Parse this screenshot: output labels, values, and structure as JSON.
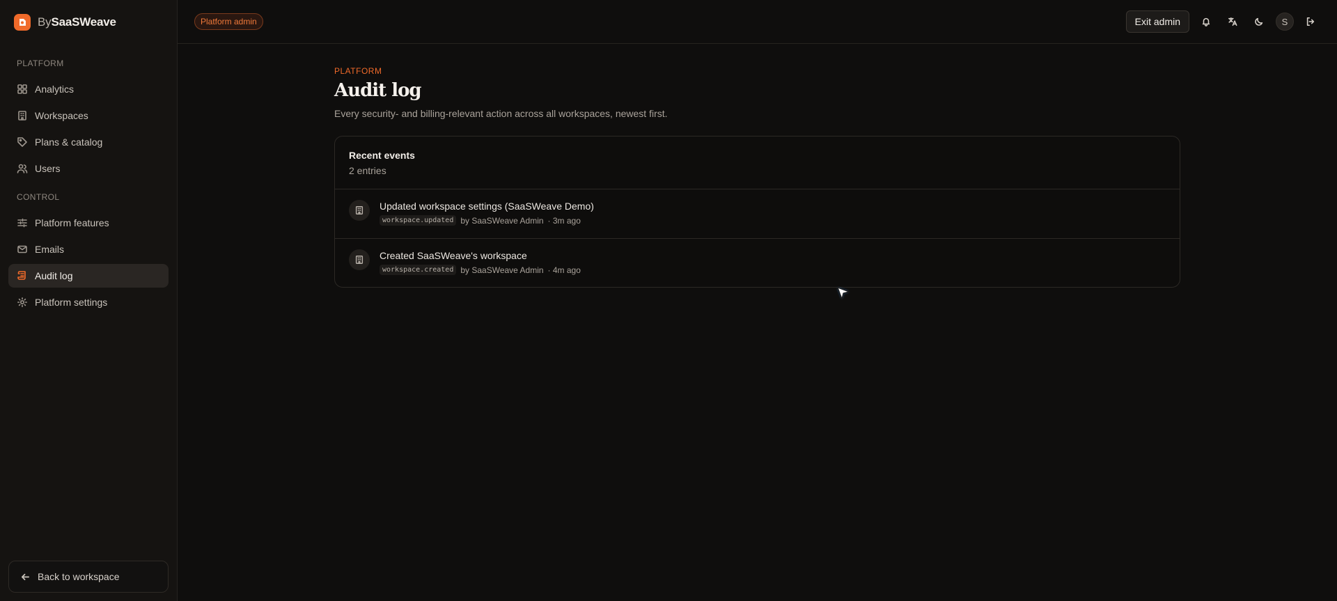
{
  "brand": {
    "prefix": "By",
    "name": "SaaSWeave"
  },
  "sidebar": {
    "sections": [
      {
        "heading": "PLATFORM",
        "items": [
          {
            "label": "Analytics",
            "icon": "grid-icon"
          },
          {
            "label": "Workspaces",
            "icon": "building-icon"
          },
          {
            "label": "Plans & catalog",
            "icon": "tag-icon"
          },
          {
            "label": "Users",
            "icon": "users-icon"
          }
        ]
      },
      {
        "heading": "CONTROL",
        "items": [
          {
            "label": "Platform features",
            "icon": "sliders-icon"
          },
          {
            "label": "Emails",
            "icon": "mail-icon"
          },
          {
            "label": "Audit log",
            "icon": "scroll-icon",
            "active": true
          },
          {
            "label": "Platform settings",
            "icon": "gear-icon"
          }
        ]
      }
    ],
    "back_label": "Back to workspace"
  },
  "topbar": {
    "badge": "Platform admin",
    "exit_label": "Exit admin",
    "avatar_initial": "S"
  },
  "page": {
    "eyebrow": "PLATFORM",
    "title": "Audit log",
    "subtitle": "Every security- and billing-relevant action across all workspaces, newest first."
  },
  "card": {
    "title": "Recent events",
    "count": "2 entries",
    "events": [
      {
        "title": "Updated workspace settings (SaaSWeave Demo)",
        "code": "workspace.updated",
        "actor": "by SaaSWeave Admin",
        "time": "· 3m ago"
      },
      {
        "title": "Created SaaSWeave's workspace",
        "code": "workspace.created",
        "actor": "by SaaSWeave Admin",
        "time": "· 4m ago"
      }
    ]
  },
  "colors": {
    "accent": "#f06a2a",
    "background": "#0f0e0d",
    "sidebar": "#151311"
  }
}
